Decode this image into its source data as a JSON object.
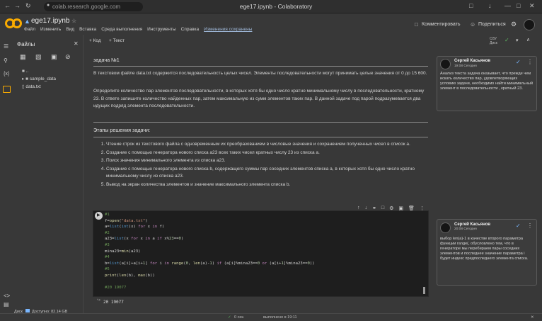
{
  "browser": {
    "url": "colab.research.google.com",
    "window_title": "ege17.ipynb - Colaboratory"
  },
  "header": {
    "file_name": "ege17.ipynb",
    "menu": [
      "Файл",
      "Изменить",
      "Вид",
      "Вставка",
      "Среда выполнения",
      "Инструменты",
      "Справка"
    ],
    "saved_status": "Изменения сохранены",
    "comment_btn": "Комментировать",
    "share_btn": "Поделиться"
  },
  "toolbar": {
    "add_code": "+ Код",
    "add_text": "+ Текст",
    "ram": "ОЗУ",
    "disk": "Диск"
  },
  "files": {
    "title": "Файлы",
    "items": [
      "..",
      "sample_data",
      "data.txt"
    ]
  },
  "disk_info": {
    "label": "Диск",
    "available": "Доступно: 82.14 GB"
  },
  "notebook": {
    "task_title": "задача №1",
    "paragraph1": "В текстовом файле data.txt содержится последовательность целых чисел. Элементы последовательности могут принимать целые значения от 0 до 15 600.",
    "paragraph2": "Определите количество пар элементов последовательности, в которых хотя бы одно число кратно минимальному числу в последовательности, кратному 23. В ответе запишите количество найденных пар, затем максимальную из сумм элементов таких пар. В данной задаче под парой подразумевается два идущих подряд элемента последовательности.",
    "stages_title": "Этапы решения задачи:",
    "steps": [
      "Чтение строк из текстового файла с одновременным их преобразованием в числовые значения и сохранением полученных чисел в список a.",
      "Создание с помощью генератора нового списка a23 всех таких чисел кратных числу 23 из списка a.",
      "Поиск значения минимального элемента из списка a23.",
      "Создание с помощью генератора нового списка b, содержащего суммы пар соседних элементов списка a, в которых хотя бы одно число кратно минимальному числу из списка a23.",
      "Вывод на экран количества элементов и значение максимального элемента списка b."
    ],
    "output": "20 19077"
  },
  "comments": [
    {
      "author": "Сергей Касьянов",
      "date": "19:08 Сегодня",
      "body": "Анализ текста задача оказывает, что прежде чем искать количество пар, удовлетворяющих условию задачи, необходимо найти минимальный элемент в последовательности , кратный 23."
    },
    {
      "author": "Сергей Касьянов",
      "date": "20:08 Сегодня",
      "body": "выбор len(a)-1 в качестве второго параметра функции range(, обусловлено тем, что в генераторе мы перебираем пары соседних элементов и последнее значение параметра i будет индекс предпоследнего элемента списка."
    }
  ],
  "status": {
    "done": "0 сек.",
    "completed": "выполнено в 19:11"
  }
}
